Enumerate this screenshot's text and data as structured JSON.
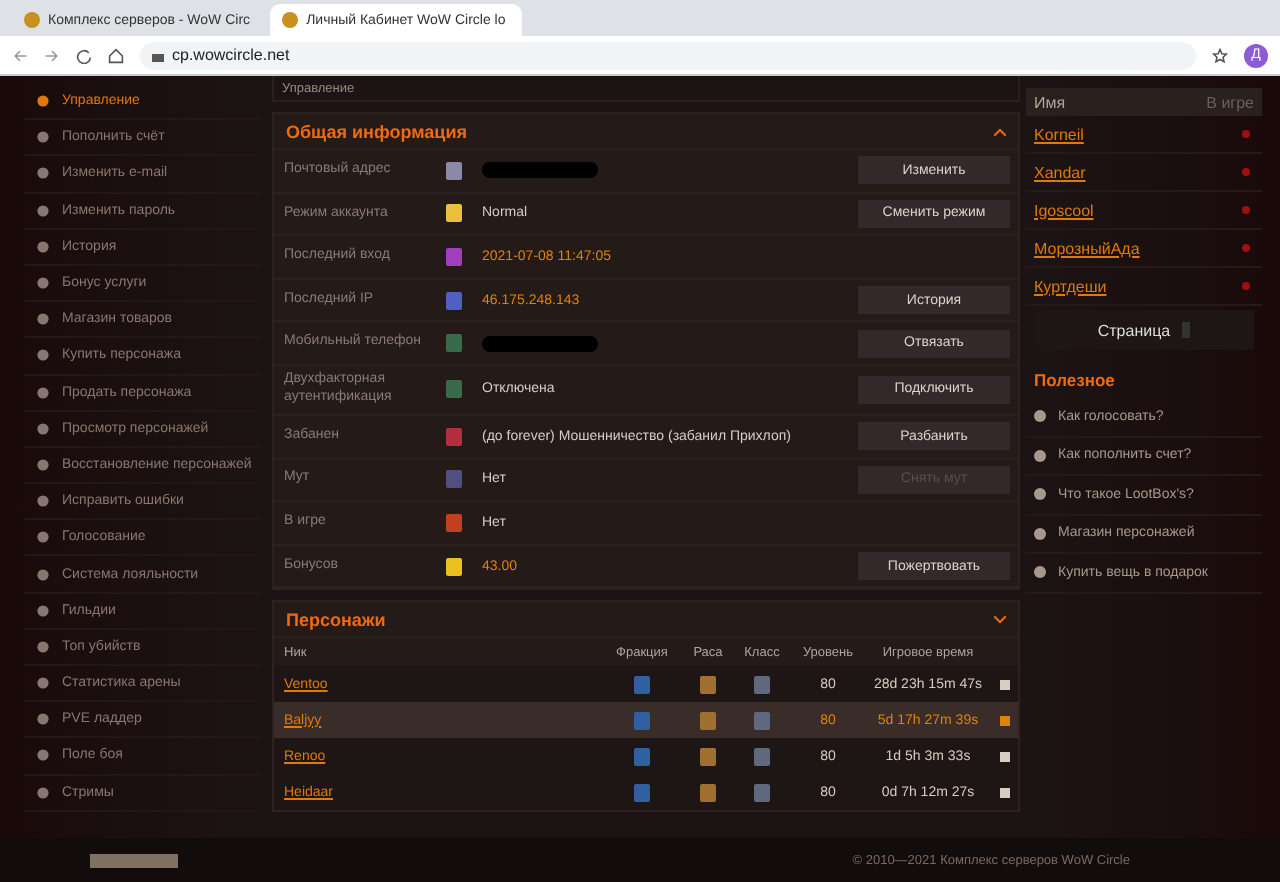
{
  "browser": {
    "tabs": [
      {
        "title": "Комплекс серверов - WoW Circ",
        "selected": false
      },
      {
        "title": "Личный Кабинет WoW Circle lo",
        "selected": true
      }
    ],
    "url": "cp.wowcircle.net",
    "avatar": "Д"
  },
  "sidebar": {
    "items": [
      {
        "label": "Управление",
        "selected": true
      },
      {
        "label": "Пополнить счёт",
        "selected": false
      },
      {
        "label": "Изменить e-mail",
        "selected": false
      },
      {
        "label": "Изменить пароль",
        "selected": false
      },
      {
        "label": "История",
        "selected": false
      },
      {
        "label": "Бонус услуги",
        "selected": false
      },
      {
        "label": "Магазин товаров",
        "selected": false
      },
      {
        "label": "Купить персонажа",
        "selected": false
      },
      {
        "label": "Продать персонажа",
        "selected": false
      },
      {
        "label": "Просмотр персонажей",
        "selected": false
      },
      {
        "label": "Восстановление персонажей",
        "selected": false
      },
      {
        "label": "Исправить ошибки",
        "selected": false
      },
      {
        "label": "Голосование",
        "selected": false
      },
      {
        "label": "Система лояльности",
        "selected": false
      },
      {
        "label": "Гильдии",
        "selected": false
      },
      {
        "label": "Топ убийств",
        "selected": false
      },
      {
        "label": "Статистика арены",
        "selected": false
      },
      {
        "label": "PVE ладдер",
        "selected": false
      },
      {
        "label": "Поле боя",
        "selected": false
      },
      {
        "label": "Стримы",
        "selected": false
      }
    ]
  },
  "breadcrumb": "Управление",
  "info": {
    "title": "Общая информация",
    "rows": [
      {
        "label": "Почтовый адрес",
        "kind": "hidden",
        "button": "Изменить",
        "button_disabled": false
      },
      {
        "label": "Режим аккаунта",
        "kind": "plain",
        "value": "Normal",
        "button": "Сменить режим",
        "button_disabled": false
      },
      {
        "label": "Последний вход",
        "kind": "accent",
        "value": "2021-07-08 11:47:05"
      },
      {
        "label": "Последний IP",
        "kind": "accent",
        "value": "46.175.248.143",
        "button": "История",
        "button_disabled": false
      },
      {
        "label": "Мобильный телефон",
        "kind": "hidden",
        "button": "Отвязать",
        "button_disabled": false
      },
      {
        "label": "Двухфакторная аутентификация",
        "kind": "plain",
        "value": "Отключена",
        "button": "Подключить",
        "button_disabled": false
      },
      {
        "label": "Забанен",
        "kind": "plain",
        "value": "(до forever) Мошенничество (забанил Прихлоп)",
        "button": "Разбанить",
        "button_disabled": false
      },
      {
        "label": "Мут",
        "kind": "plain",
        "value": "Нет",
        "button": "Снять мут",
        "button_disabled": true
      },
      {
        "label": "В игре",
        "kind": "plain",
        "value": "Нет"
      },
      {
        "label": "Бонусов",
        "kind": "accent",
        "value": "43.00",
        "button": "Пожертвовать",
        "button_disabled": false
      }
    ]
  },
  "characters": {
    "title": "Персонажи",
    "columns": [
      "Ник",
      "Фракция",
      "Раса",
      "Класс",
      "Уровень",
      "Игровое время"
    ],
    "rows": [
      {
        "name": "Ventoo",
        "level": "80",
        "time": "28d 23h 15m 47s",
        "selected": false
      },
      {
        "name": "Baljyy",
        "level": "80",
        "time": "5d 17h 27m 39s",
        "selected": true
      },
      {
        "name": "Renoo",
        "level": "80",
        "time": "1d 5h 3m 33s",
        "selected": false
      },
      {
        "name": "Heidaar",
        "level": "80",
        "time": "0d 7h 12m 27s",
        "selected": false
      }
    ]
  },
  "friends": {
    "columns": [
      "Имя",
      "В игре"
    ],
    "items": [
      {
        "name": "Korneil",
        "online": false
      },
      {
        "name": "Xandar",
        "online": false
      },
      {
        "name": "Igoscool",
        "online": false
      },
      {
        "name": "МорозныйАда",
        "online": false
      },
      {
        "name": "Куртдеши",
        "online": false
      }
    ],
    "pager_label": "Страница"
  },
  "useful": {
    "title": "Полезное",
    "items": [
      "Как голосовать?",
      "Как пополнить счет?",
      "Что такое LootBox's?",
      "Магазин персонажей",
      "Купить вещь в подарок"
    ]
  },
  "footer": {
    "copyright": "© 2010—2021 Комплекс серверов WoW Circle"
  }
}
